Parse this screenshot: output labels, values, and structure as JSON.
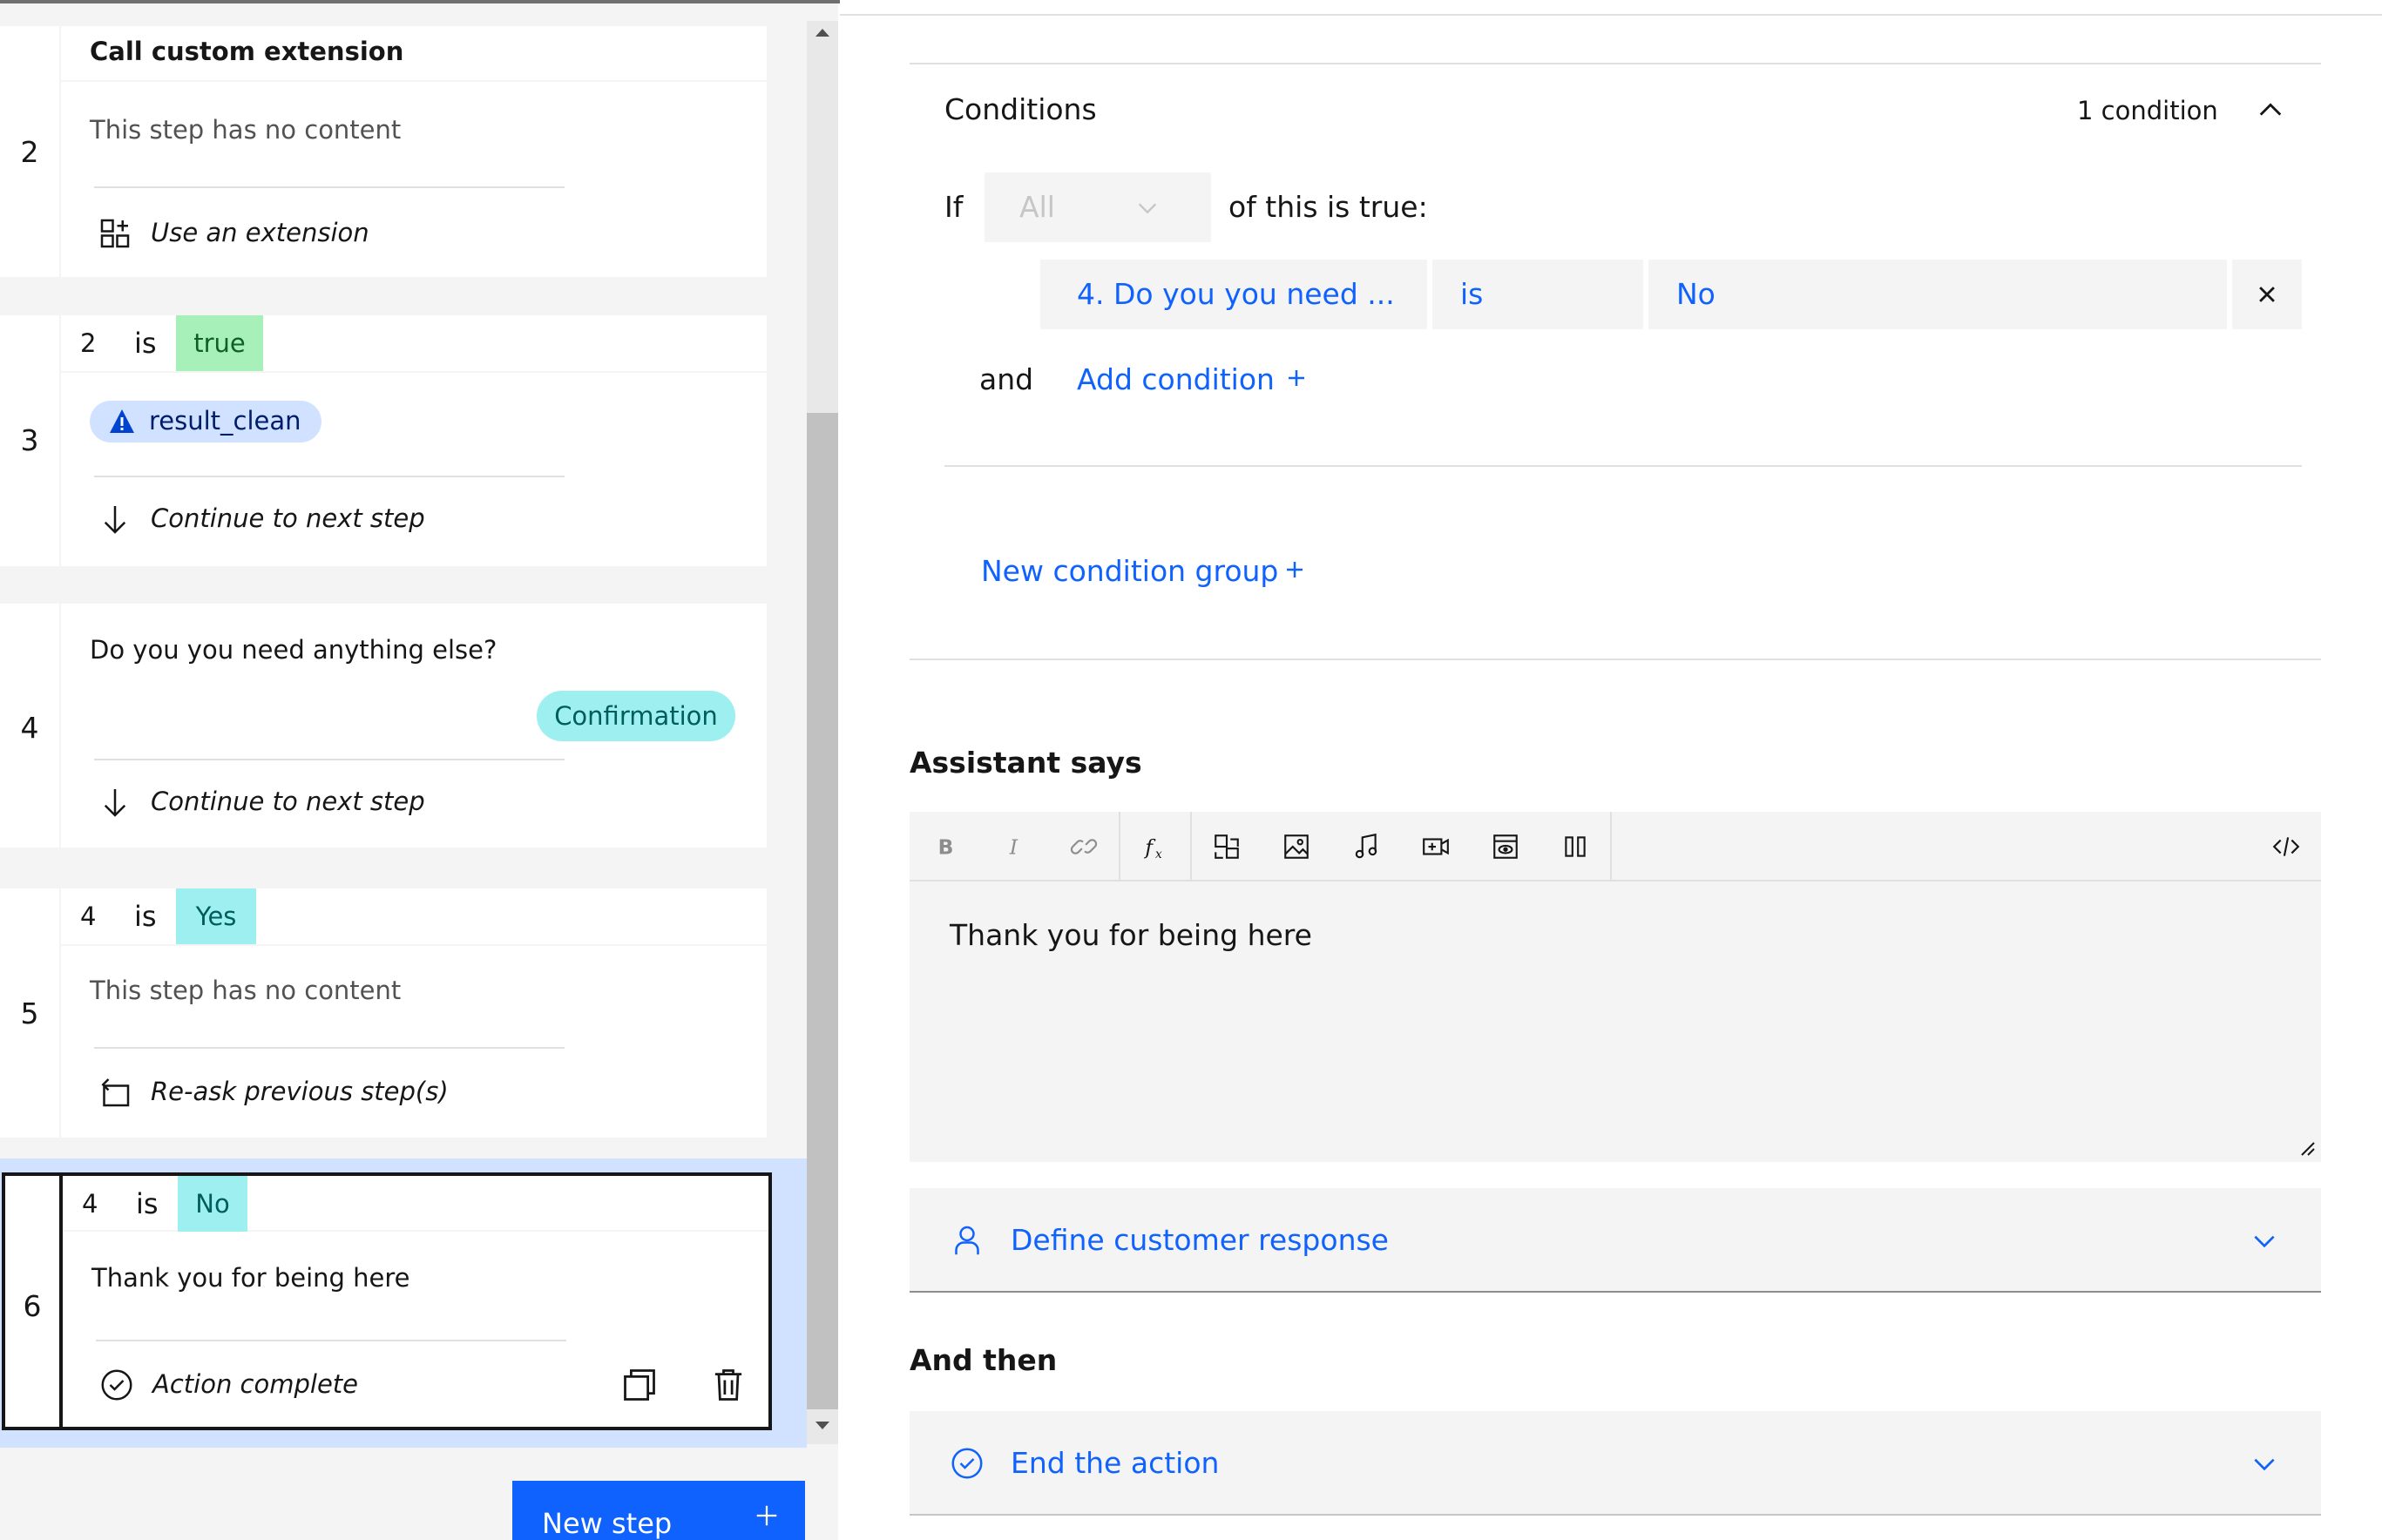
{
  "steps": [
    {
      "number": "2",
      "title": "Call custom extension",
      "content": "This step has no content",
      "action": "Use an extension"
    },
    {
      "number": "3",
      "condition": {
        "step": "2",
        "op": "is",
        "value": "true"
      },
      "variable": "result_clean",
      "action": "Continue to next step"
    },
    {
      "number": "4",
      "content": "Do you you need anything else?",
      "response_type": "Confirmation",
      "action": "Continue to next step"
    },
    {
      "number": "5",
      "condition": {
        "step": "4",
        "op": "is",
        "value": "Yes"
      },
      "content": "This step has no content",
      "action": "Re-ask previous step(s)"
    },
    {
      "number": "6",
      "condition": {
        "step": "4",
        "op": "is",
        "value": "No"
      },
      "content": "Thank you for being here",
      "action": "Action complete"
    }
  ],
  "new_step_label": "New step",
  "conditions": {
    "title": "Conditions",
    "count": "1 condition",
    "if_label": "If",
    "quantifier": "All",
    "suffix": "of this is true:",
    "rows": [
      {
        "subject": "4. Do you you need ...",
        "operator": "is",
        "value": "No"
      }
    ],
    "and_label": "and",
    "add_condition": "Add condition",
    "new_group": "New condition group"
  },
  "assistant_says": {
    "heading": "Assistant says",
    "text": "Thank you for being here"
  },
  "customer_response": "Define customer response",
  "and_then": {
    "heading": "And then",
    "action": "End the action"
  },
  "colors": {
    "accent": "#0f62fe",
    "true_tag": "#a7f0ba",
    "teal_tag": "#9ef0f0",
    "var_tag": "#d0e2ff",
    "selected_bg": "#d0e2ff"
  }
}
